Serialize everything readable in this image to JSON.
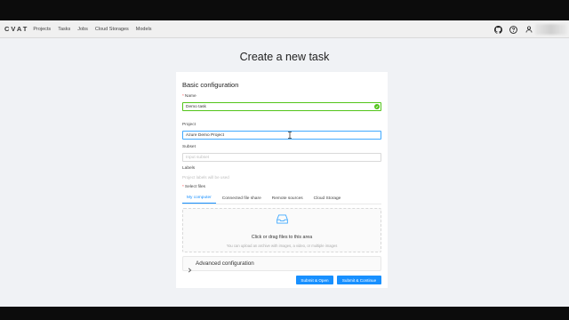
{
  "header": {
    "logo": "CVAT",
    "nav": [
      "Projects",
      "Tasks",
      "Jobs",
      "Cloud Storages",
      "Models"
    ]
  },
  "page": {
    "title": "Create a new task"
  },
  "form": {
    "section_title": "Basic configuration",
    "name": {
      "label": "Name",
      "value": "Demo task"
    },
    "project": {
      "label": "Project",
      "value": "Azure Demo Project"
    },
    "subset": {
      "label": "Subset",
      "placeholder": "Input subset"
    },
    "labels": {
      "label": "Labels",
      "hint": "Project labels will be used"
    },
    "select_files": {
      "label": "Select files",
      "tabs": [
        "My computer",
        "Connected file share",
        "Remote sources",
        "Cloud Storage"
      ],
      "active_tab": "My computer"
    },
    "dropzone": {
      "text": "Click or drag files to this area",
      "hint": "You can upload an archive with images, a video, or multiple images"
    },
    "advanced": {
      "label": "Advanced configuration"
    },
    "buttons": {
      "submit_open": "Submit & Open",
      "submit_continue": "Submit & Continue"
    }
  },
  "colors": {
    "primary": "#1890ff",
    "success": "#52c41a",
    "background": "#f0f2f5"
  }
}
